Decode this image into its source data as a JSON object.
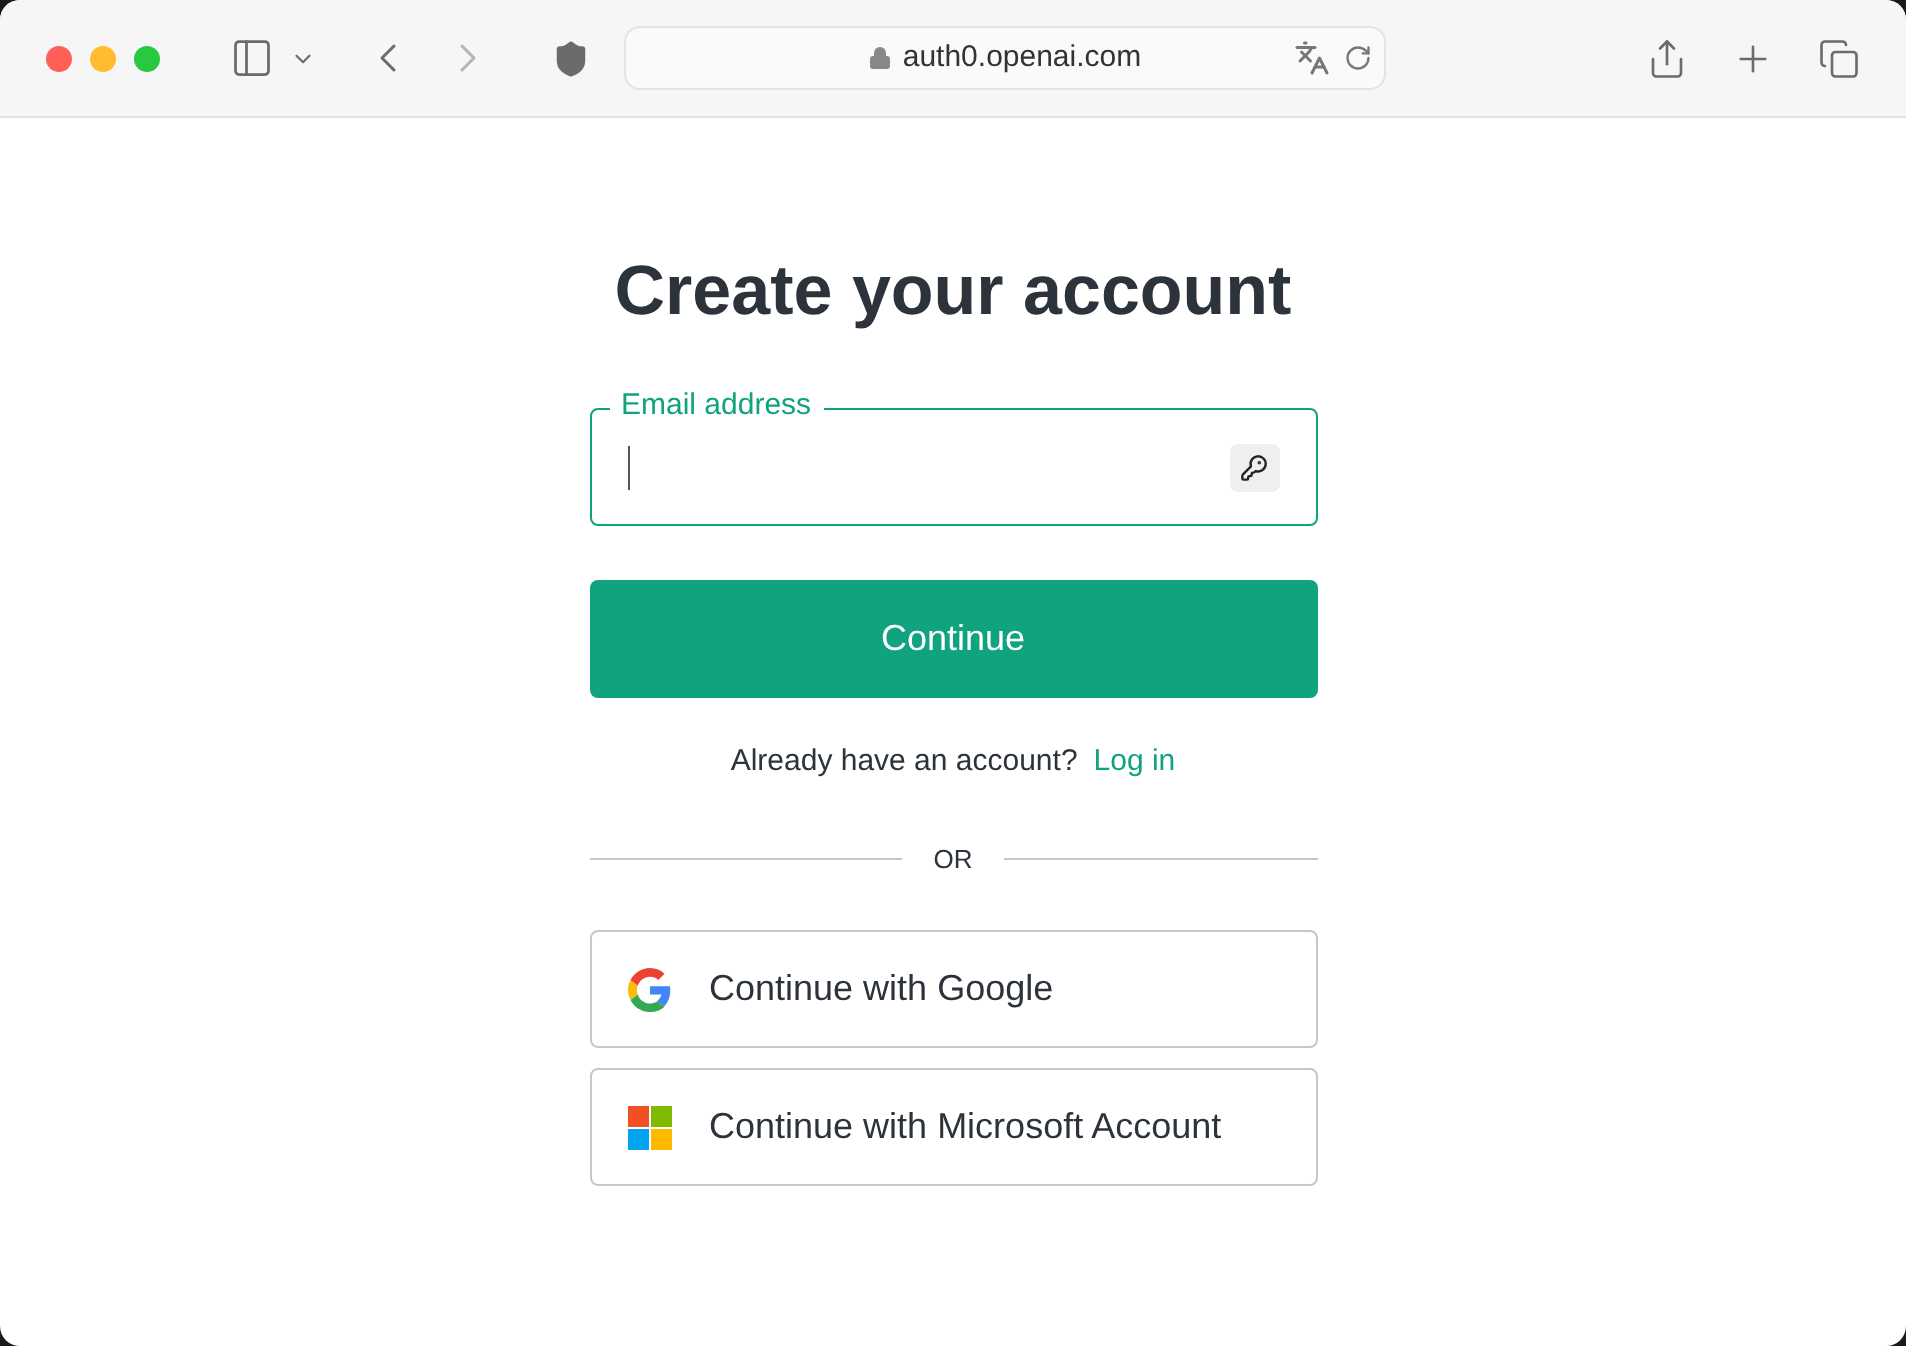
{
  "browser": {
    "url": "auth0.openai.com"
  },
  "heading": "Create your account",
  "email_field": {
    "label": "Email address"
  },
  "continue_button": "Continue",
  "login_prompt": {
    "text": "Already have an account?",
    "link": "Log in"
  },
  "divider": "OR",
  "social_buttons": [
    {
      "kind": "google",
      "label": "Continue with Google"
    },
    {
      "kind": "microsoft",
      "label": "Continue with Microsoft Account"
    }
  ]
}
